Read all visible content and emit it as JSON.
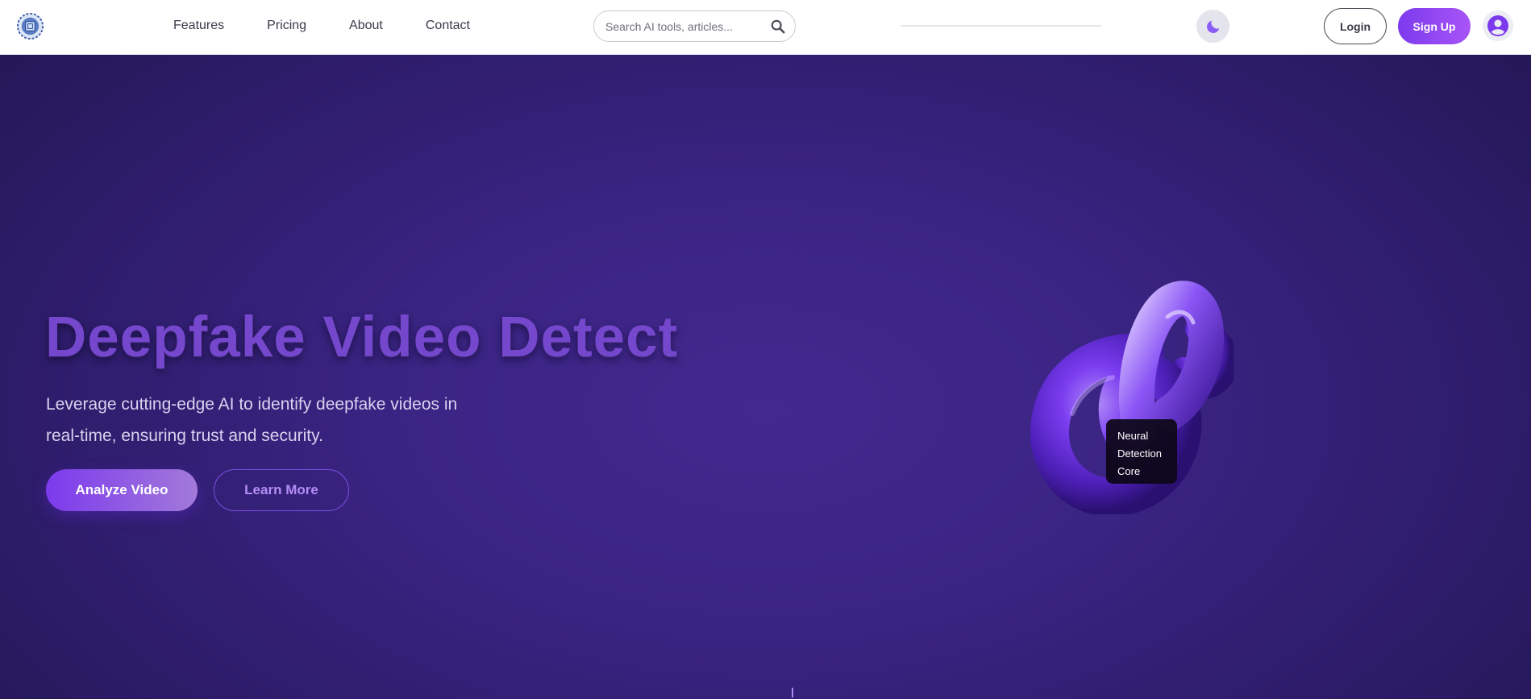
{
  "nav": {
    "links": [
      "Features",
      "Pricing",
      "About",
      "Contact"
    ],
    "search_placeholder": "Search AI tools, articles...",
    "search_value": "",
    "scroll_progress_percent": 0,
    "login_label": "Login",
    "signup_label": "Sign Up",
    "icons": {
      "logo": "brain-chip-logo-icon",
      "search": "search-icon",
      "theme": "moon-icon",
      "avatar": "user-circle-icon"
    }
  },
  "hero": {
    "title": "Deepfake Video Detect",
    "subtitle": "Leverage cutting-edge AI to identify deepfake videos in real-time, ensuring trust and security.",
    "primary_cta": "Analyze Video",
    "secondary_cta": "Learn More",
    "model_label": "Neural Detection Core"
  },
  "colors": {
    "accent": "#7c3aed",
    "accent_light": "#a855f7",
    "hero_bg": "#3a2483",
    "title": "#7447cc"
  }
}
